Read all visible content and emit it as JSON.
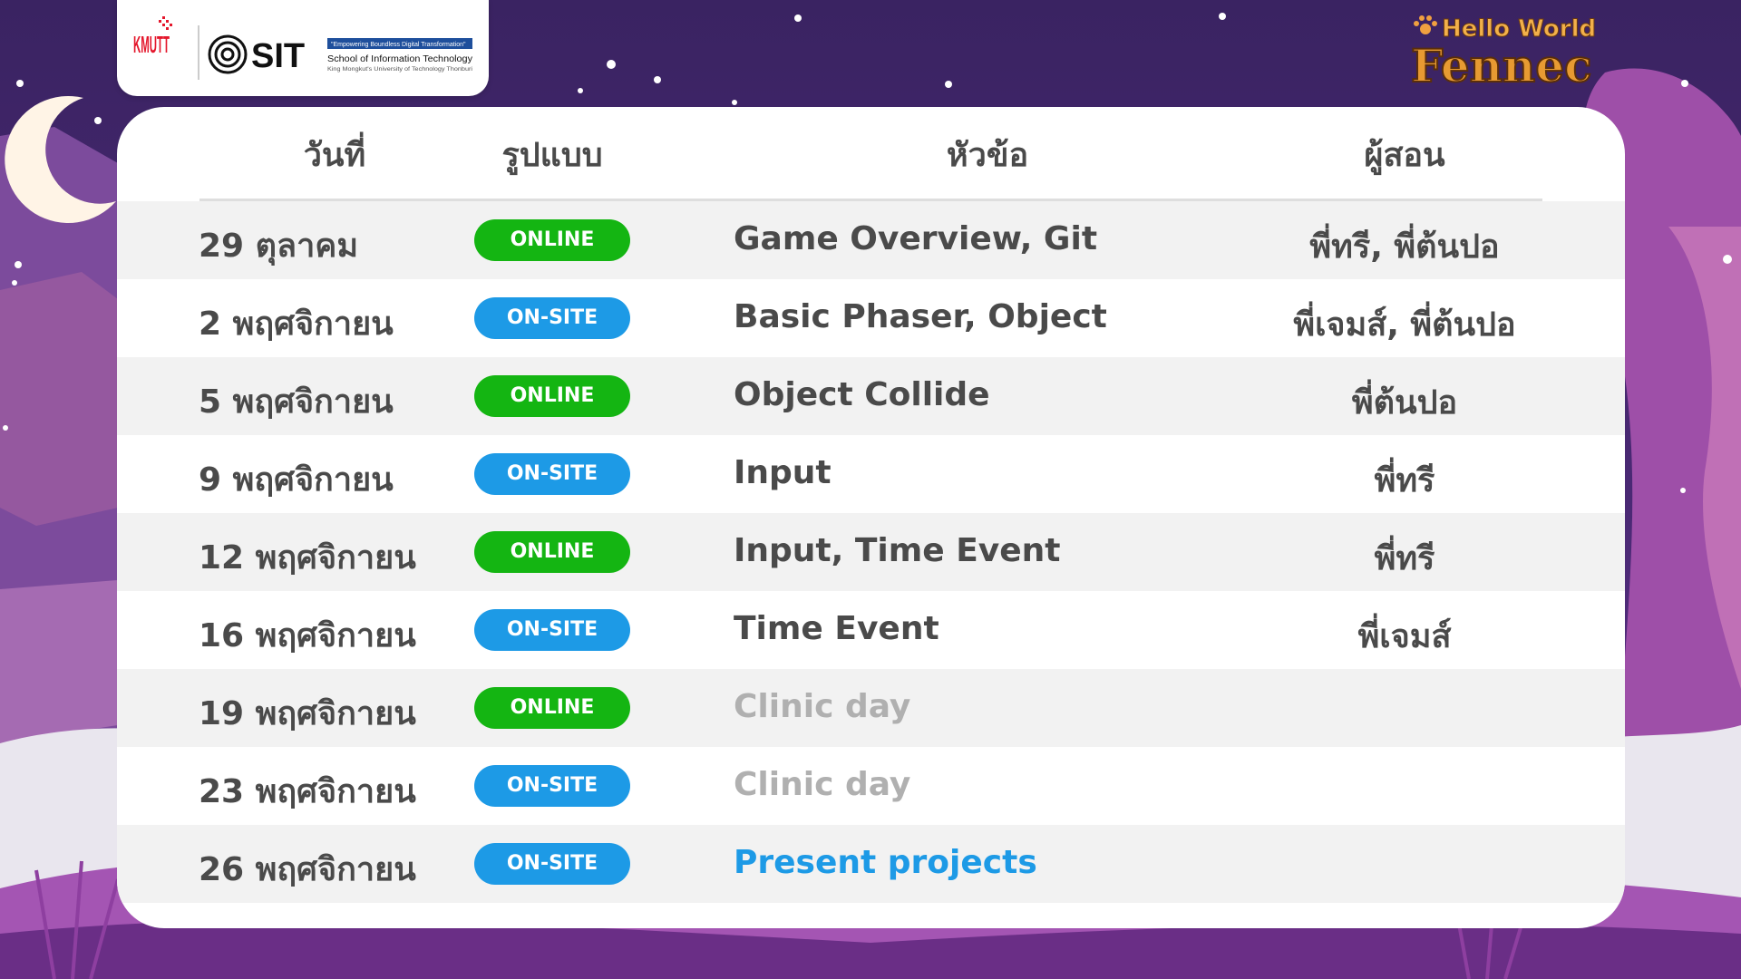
{
  "logos": {
    "kmutt": "KMUTT",
    "sit": "SIT",
    "tagline": "\"Empowering Boundless Digital Transformation\"",
    "school_name": "School of Information Technology",
    "university": "King Mongkut's University of Technology Thonburi"
  },
  "brand": {
    "line1": "Hello World",
    "line2": "Fennec"
  },
  "table": {
    "headers": {
      "date": "วันที่",
      "format": "รูปแบบ",
      "topic": "หัวข้อ",
      "lecturer": "ผู้สอน"
    },
    "rows": [
      {
        "date": "29 ตุลาคม",
        "format": "ONLINE",
        "topic": "Game Overview, Git",
        "lecturer": "พี่ทรี, พี่ต้นปอ"
      },
      {
        "date": "2 พฤศจิกายน",
        "format": "ON-SITE",
        "topic": "Basic Phaser, Object",
        "lecturer": "พี่เจมส์, พี่ต้นปอ"
      },
      {
        "date": "5 พฤศจิกายน",
        "format": "ONLINE",
        "topic": "Object Collide",
        "lecturer": "พี่ต้นปอ"
      },
      {
        "date": "9 พฤศจิกายน",
        "format": "ON-SITE",
        "topic": "Input",
        "lecturer": "พี่ทรี"
      },
      {
        "date": "12 พฤศจิกายน",
        "format": "ONLINE",
        "topic": "Input, Time Event",
        "lecturer": "พี่ทรี"
      },
      {
        "date": "16 พฤศจิกายน",
        "format": "ON-SITE",
        "topic": "Time Event",
        "lecturer": "พี่เจมส์"
      },
      {
        "date": "19 พฤศจิกายน",
        "format": "ONLINE",
        "topic": "Clinic day",
        "lecturer": ""
      },
      {
        "date": "23 พฤศจิกายน",
        "format": "ON-SITE",
        "topic": "Clinic day",
        "lecturer": ""
      },
      {
        "date": "26 พฤศจิกายน",
        "format": "ON-SITE",
        "topic": "Present projects",
        "lecturer": ""
      }
    ]
  },
  "colors": {
    "online": "#14b512",
    "onsite": "#1d9ae6",
    "present_projects": "#1d9ae6",
    "clinic_day": "#b0b0b0",
    "background": "#3d2466"
  }
}
